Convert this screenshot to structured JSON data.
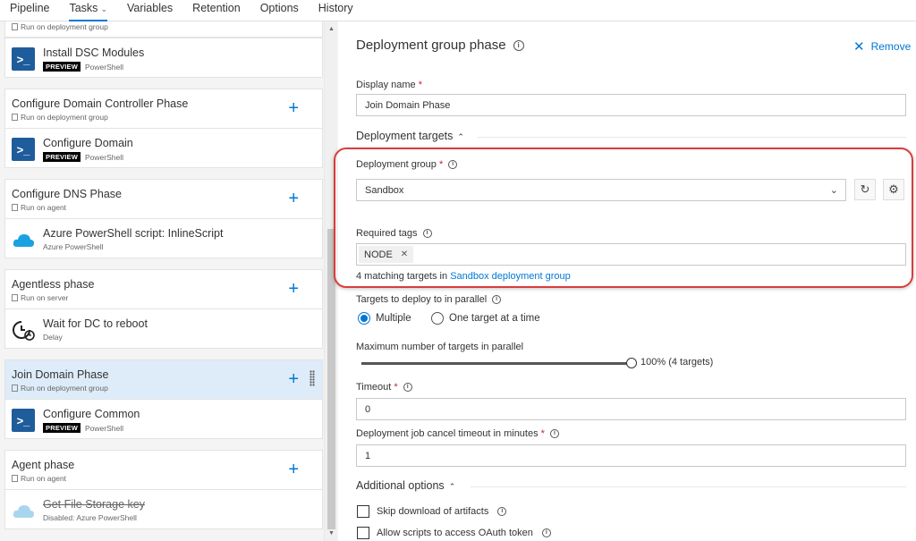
{
  "nav": {
    "tabs": [
      {
        "label": "Pipeline"
      },
      {
        "label": "Tasks"
      },
      {
        "label": "Variables"
      },
      {
        "label": "Retention"
      },
      {
        "label": "Options"
      },
      {
        "label": "History"
      }
    ]
  },
  "left": {
    "top_partial_sub": "Run on deployment group",
    "t1": {
      "title": "Install DSC Modules",
      "badge": "PREVIEW",
      "sub": "PowerShell"
    },
    "p1": {
      "title": "Configure Domain Controller Phase",
      "sub": "Run on deployment group"
    },
    "t2": {
      "title": "Configure Domain",
      "badge": "PREVIEW",
      "sub": "PowerShell"
    },
    "p2": {
      "title": "Configure DNS Phase",
      "sub": "Run on agent"
    },
    "t3": {
      "title": "Azure PowerShell script: InlineScript",
      "sub": "Azure PowerShell"
    },
    "p3": {
      "title": "Agentless phase",
      "sub": "Run on server"
    },
    "t4": {
      "title": "Wait for DC to reboot",
      "sub": "Delay"
    },
    "p4": {
      "title": "Join Domain Phase",
      "sub": "Run on deployment group"
    },
    "t5": {
      "title": "Configure Common",
      "badge": "PREVIEW",
      "sub": "PowerShell"
    },
    "p5": {
      "title": "Agent phase",
      "sub": "Run on agent"
    },
    "t6": {
      "title": "Get File Storage key",
      "sub": "Disabled: Azure PowerShell"
    }
  },
  "panel": {
    "title": "Deployment group phase",
    "remove": "Remove",
    "display_name_label": "Display name",
    "display_name_value": "Join Domain Phase",
    "targets_section": "Deployment targets",
    "group_label": "Deployment group",
    "group_value": "Sandbox",
    "tags_label": "Required tags",
    "tag": "NODE",
    "matching_prefix": "4 matching targets in",
    "matching_link": "Sandbox deployment group",
    "parallel_label": "Targets to deploy to in parallel",
    "opt_multiple": "Multiple",
    "opt_one": "One target at a time",
    "max_label": "Maximum number of targets in parallel",
    "max_value": "100% (4 targets)",
    "max_fraction": 1.0,
    "timeout_label": "Timeout",
    "timeout_value": "0",
    "cancel_label": "Deployment job cancel timeout in minutes",
    "cancel_value": "1",
    "additional_section": "Additional options",
    "skip_label": "Skip download of artifacts",
    "oauth_label": "Allow scripts to access OAuth token"
  },
  "colors": {
    "accent": "#0078d4",
    "highlight": "#d93c3c",
    "selected": "#deecf9"
  }
}
